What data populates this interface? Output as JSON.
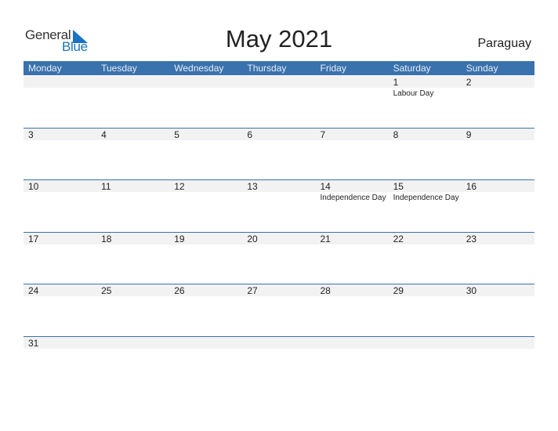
{
  "logo": {
    "general": "General",
    "blue": "Blue"
  },
  "title": "May 2021",
  "country": "Paraguay",
  "weekdays": [
    "Monday",
    "Tuesday",
    "Wednesday",
    "Thursday",
    "Friday",
    "Saturday",
    "Sunday"
  ],
  "weeks": [
    {
      "days": [
        {
          "num": "",
          "holiday": ""
        },
        {
          "num": "",
          "holiday": ""
        },
        {
          "num": "",
          "holiday": ""
        },
        {
          "num": "",
          "holiday": ""
        },
        {
          "num": "",
          "holiday": ""
        },
        {
          "num": "1",
          "holiday": "Labour Day"
        },
        {
          "num": "2",
          "holiday": ""
        }
      ]
    },
    {
      "days": [
        {
          "num": "3",
          "holiday": ""
        },
        {
          "num": "4",
          "holiday": ""
        },
        {
          "num": "5",
          "holiday": ""
        },
        {
          "num": "6",
          "holiday": ""
        },
        {
          "num": "7",
          "holiday": ""
        },
        {
          "num": "8",
          "holiday": ""
        },
        {
          "num": "9",
          "holiday": ""
        }
      ]
    },
    {
      "days": [
        {
          "num": "10",
          "holiday": ""
        },
        {
          "num": "11",
          "holiday": ""
        },
        {
          "num": "12",
          "holiday": ""
        },
        {
          "num": "13",
          "holiday": ""
        },
        {
          "num": "14",
          "holiday": "Independence Day"
        },
        {
          "num": "15",
          "holiday": "Independence Day"
        },
        {
          "num": "16",
          "holiday": ""
        }
      ]
    },
    {
      "days": [
        {
          "num": "17",
          "holiday": ""
        },
        {
          "num": "18",
          "holiday": ""
        },
        {
          "num": "19",
          "holiday": ""
        },
        {
          "num": "20",
          "holiday": ""
        },
        {
          "num": "21",
          "holiday": ""
        },
        {
          "num": "22",
          "holiday": ""
        },
        {
          "num": "23",
          "holiday": ""
        }
      ]
    },
    {
      "days": [
        {
          "num": "24",
          "holiday": ""
        },
        {
          "num": "25",
          "holiday": ""
        },
        {
          "num": "26",
          "holiday": ""
        },
        {
          "num": "27",
          "holiday": ""
        },
        {
          "num": "28",
          "holiday": ""
        },
        {
          "num": "29",
          "holiday": ""
        },
        {
          "num": "30",
          "holiday": ""
        }
      ]
    },
    {
      "days": [
        {
          "num": "31",
          "holiday": ""
        },
        {
          "num": "",
          "holiday": ""
        },
        {
          "num": "",
          "holiday": ""
        },
        {
          "num": "",
          "holiday": ""
        },
        {
          "num": "",
          "holiday": ""
        },
        {
          "num": "",
          "holiday": ""
        },
        {
          "num": "",
          "holiday": ""
        }
      ]
    }
  ]
}
